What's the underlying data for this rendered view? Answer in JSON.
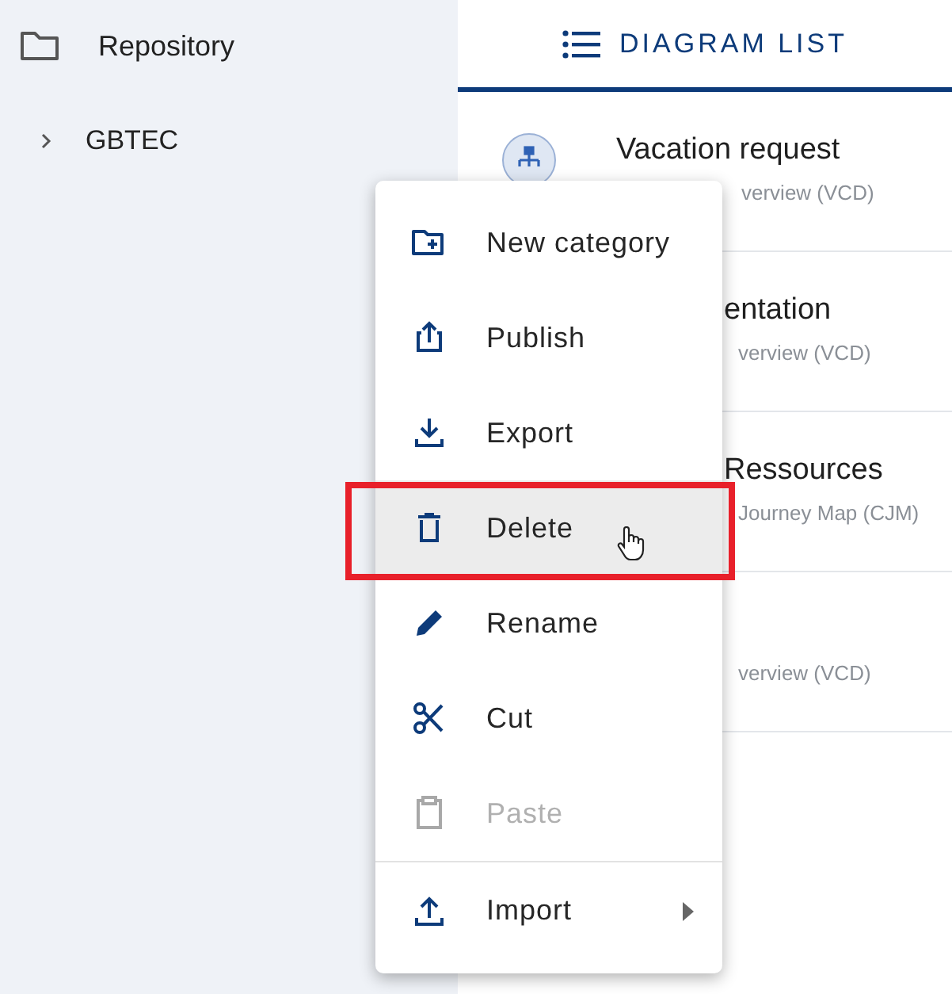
{
  "sidebar": {
    "root": {
      "label": "Repository"
    },
    "items": [
      {
        "label": "GBTEC",
        "expanded": false
      }
    ]
  },
  "tab": {
    "label": "DIAGRAM LIST",
    "selected": true
  },
  "diagrams": [
    {
      "kind": "avatar",
      "title": "Vacation request",
      "subtitle": "verview (VCD)"
    },
    {
      "kind": "plain",
      "title": "entation",
      "subtitle": "verview (VCD)"
    },
    {
      "kind": "plain",
      "title": "Ressources",
      "subtitle": "Journey Map (CJM)"
    },
    {
      "kind": "plain",
      "subtitle": "verview (VCD)"
    }
  ],
  "context_menu": {
    "items": [
      {
        "kind": "new-category",
        "label": "New category",
        "disabled": false,
        "hovered": false
      },
      {
        "kind": "publish",
        "label": "Publish",
        "disabled": false,
        "hovered": false
      },
      {
        "kind": "export",
        "label": "Export",
        "disabled": false,
        "hovered": false
      },
      {
        "kind": "delete",
        "label": "Delete",
        "disabled": false,
        "hovered": true
      },
      {
        "kind": "rename",
        "label": "Rename",
        "disabled": false,
        "hovered": false
      },
      {
        "kind": "cut",
        "label": "Cut",
        "disabled": false,
        "hovered": false
      },
      {
        "kind": "paste",
        "label": "Paste",
        "disabled": true,
        "hovered": false
      },
      {
        "kind": "import",
        "label": "Import",
        "disabled": false,
        "hovered": false,
        "submenu": true
      }
    ]
  }
}
